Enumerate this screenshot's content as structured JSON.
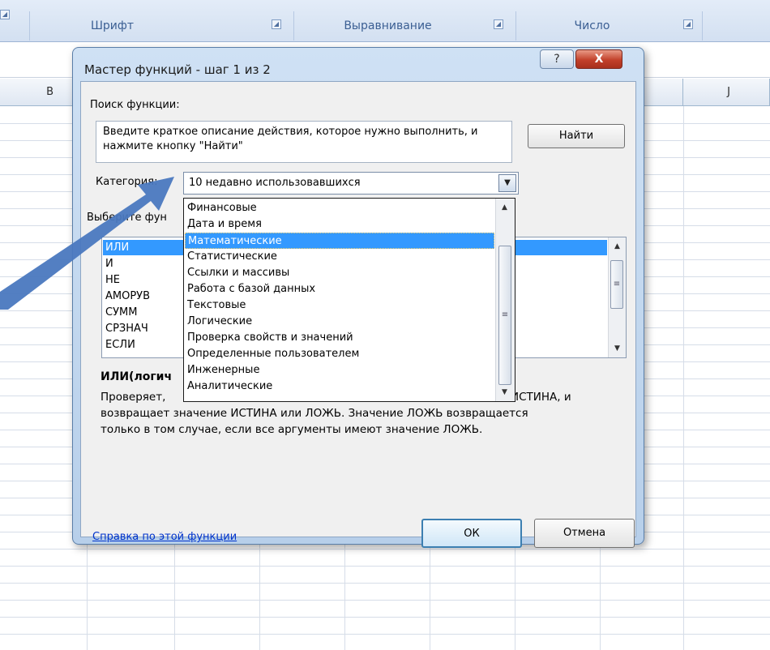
{
  "ribbon": {
    "groups": [
      {
        "label": "Шрифт"
      },
      {
        "label": "Выравнивание"
      },
      {
        "label": "Число"
      }
    ]
  },
  "sheet": {
    "columns": [
      "B",
      "J"
    ]
  },
  "dialog": {
    "title": "Мастер функций - шаг 1 из 2",
    "help_symbol": "?",
    "close_symbol": "X",
    "search_label": "Поиск функции:",
    "search_text": "Введите краткое описание действия, которое нужно выполнить, и нажмите кнопку \"Найти\"",
    "find_button": "Найти",
    "category_label": "Категория:",
    "category_value": "10 недавно использовавшихся",
    "choose_label": "Выберите фун",
    "functions": [
      "ИЛИ",
      "И",
      "НЕ",
      "АМОРУВ",
      "СУММ",
      "СРЗНАЧ",
      "ЕСЛИ"
    ],
    "selected_function": "ИЛИ",
    "signature_visible": "ИЛИ(логич",
    "signature_tail": ".)",
    "description_line1_left": "Проверяет,",
    "description_line1_right": "ИСТИНА, и",
    "description_line2": "возвращает значение ИСТИНА или ЛОЖЬ. Значение ЛОЖЬ возвращается",
    "description_line3": "только в том случае, если все аргументы имеют значение ЛОЖЬ.",
    "help_link": "Справка по этой функции",
    "ok_button": "ОК",
    "cancel_button": "Отмена"
  },
  "category_dropdown": {
    "options": [
      "Финансовые",
      "Дата и время",
      "Математические",
      "Статистические",
      "Ссылки и массивы",
      "Работа с базой данных",
      "Текстовые",
      "Логические",
      "Проверка свойств и значений",
      "Определенные пользователем",
      "Инженерные",
      "Аналитические"
    ],
    "highlighted": "Математические"
  },
  "colors": {
    "selection": "#3399ff",
    "arrow": "#4a78bf",
    "close_button": "#c2402a",
    "link": "#0033cc"
  }
}
